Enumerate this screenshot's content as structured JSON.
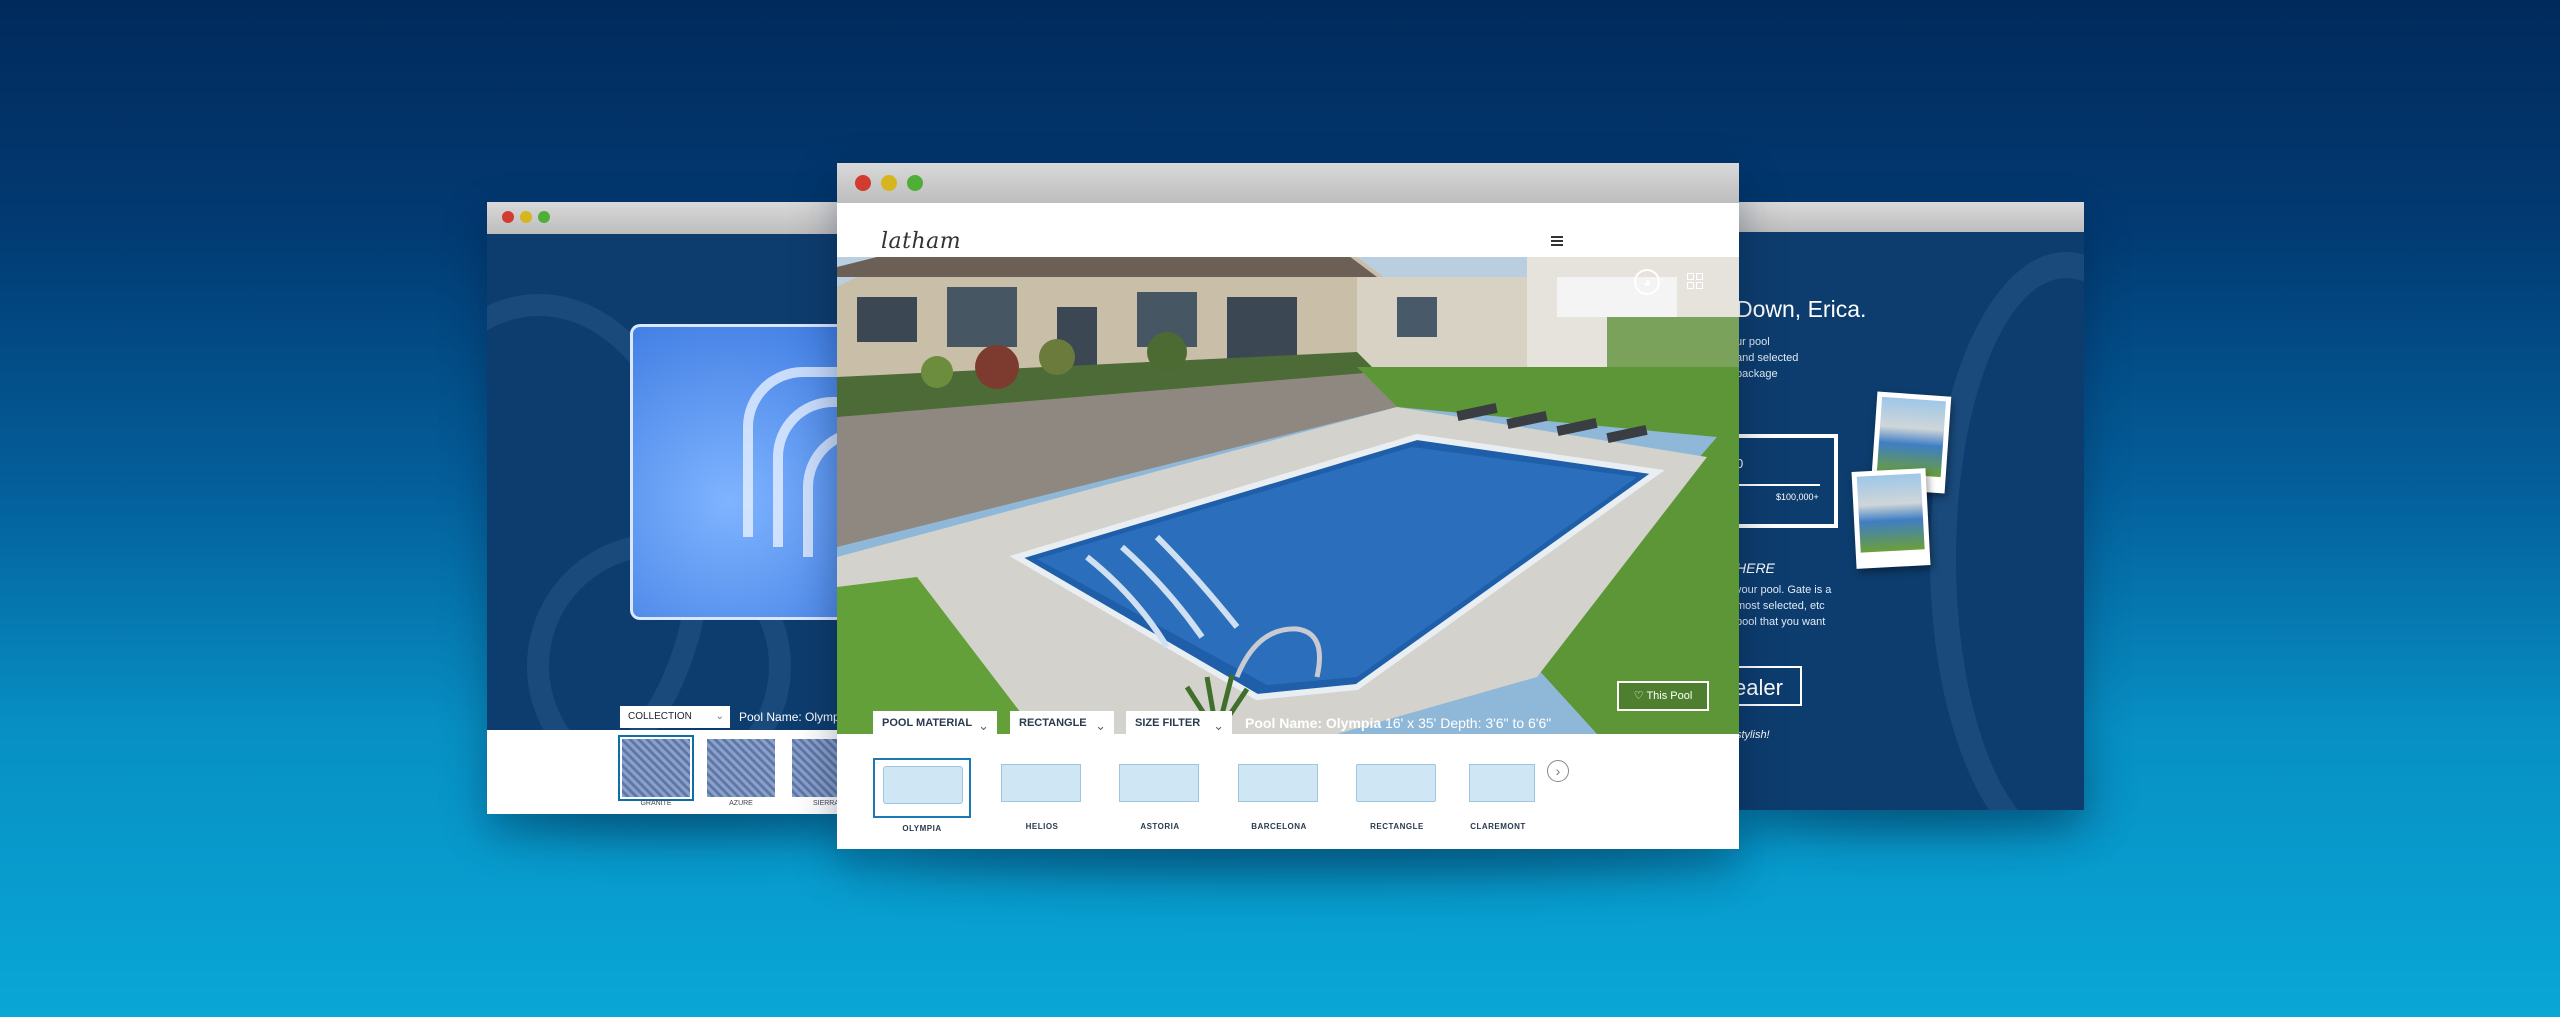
{
  "left_window": {
    "collection_label": "COLLECTION",
    "pool_name": "Pool Name: Olympia",
    "thumb_labels": [
      "GRANITE",
      "AZURE",
      "SIERRA"
    ]
  },
  "main_window": {
    "brand": "latham",
    "filters": {
      "material": "POOL MATERIAL",
      "shape": "RECTANGLE",
      "size": "SIZE FILTER"
    },
    "pool_info": {
      "name": "Pool Name: Olympia",
      "dimensions": "16' x 35' Depth: 3'6\" to 6'6\""
    },
    "love_button": "This Pool",
    "thumbnails": [
      "OLYMPIA",
      "HELIOS",
      "ASTORIA",
      "BARCELONA",
      "RECTANGLE",
      "CLAREMONT"
    ]
  },
  "right_window": {
    "title": "Down, Erica.",
    "lines_top": [
      "ur pool",
      "and selected",
      "package"
    ],
    "box_value_left": "0",
    "box_value_right": "$100,000+",
    "here_heading": "HERE",
    "lines_mid": [
      "your pool. Gate is a",
      "most selected, etc",
      "pool that you want"
    ],
    "dealer_button": "ealer",
    "stylish_note": "stylish!"
  },
  "colors": {
    "background_top": "#012a5c",
    "background_bottom": "#09a7d6",
    "panel_navy": "#0d3d6e",
    "accent_blue": "#1d79b3"
  }
}
